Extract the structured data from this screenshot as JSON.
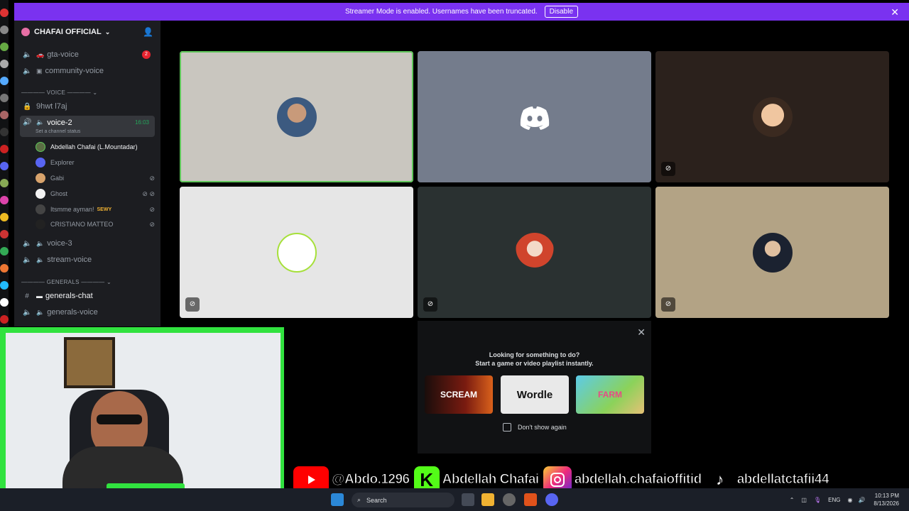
{
  "banner": {
    "text": "Streamer Mode is enabled. Usernames have been truncated.",
    "action": "Disable"
  },
  "server": {
    "name": "CHAFAI OFFICIAL"
  },
  "channels": {
    "gta": {
      "label": "gta-voice",
      "badge": "2"
    },
    "community": {
      "label": "community-voice"
    },
    "voice_category": "VOICE",
    "locked": {
      "label": "9hwt l7aj"
    },
    "active": {
      "label": "voice-2",
      "time": "16:03",
      "status": "Set a channel status"
    },
    "voice3": {
      "label": "voice-3"
    },
    "stream": {
      "label": "stream-voice"
    },
    "generals_category": "GENERALS",
    "generals_chat": {
      "label": "generals-chat"
    },
    "generals_voice": {
      "label": "generals-voice"
    }
  },
  "members": [
    {
      "name": "Abdellah Chafai (L.Mountadar)"
    },
    {
      "name": "Explorer"
    },
    {
      "name": "Gabi"
    },
    {
      "name": "Ghost"
    },
    {
      "name": "Itsmme ayman!",
      "tag": "SEWY"
    },
    {
      "name": "CRISTIANO MATTEO",
      "tag": ""
    }
  ],
  "activity": {
    "line1": "Looking for something to do?",
    "line2": "Start a game or video playlist instantly.",
    "games": [
      "SCREAM",
      "Wordle",
      "FARM"
    ],
    "dont_show": "Don't show again"
  },
  "socials": {
    "youtube": "@Abdo.1296",
    "kick": "Abdellah Chafai",
    "instagram": "abdellah.chafaioffitid",
    "tiktok": "abdellatctafii44"
  },
  "taskbar": {
    "search": "Search",
    "lang": "ENG",
    "time": "10:13 PM",
    "date": "8/13/2026"
  },
  "colors": {
    "accent": "#7a32f0",
    "speaking": "#5fc65a",
    "greenscreen": "#31e23f"
  }
}
